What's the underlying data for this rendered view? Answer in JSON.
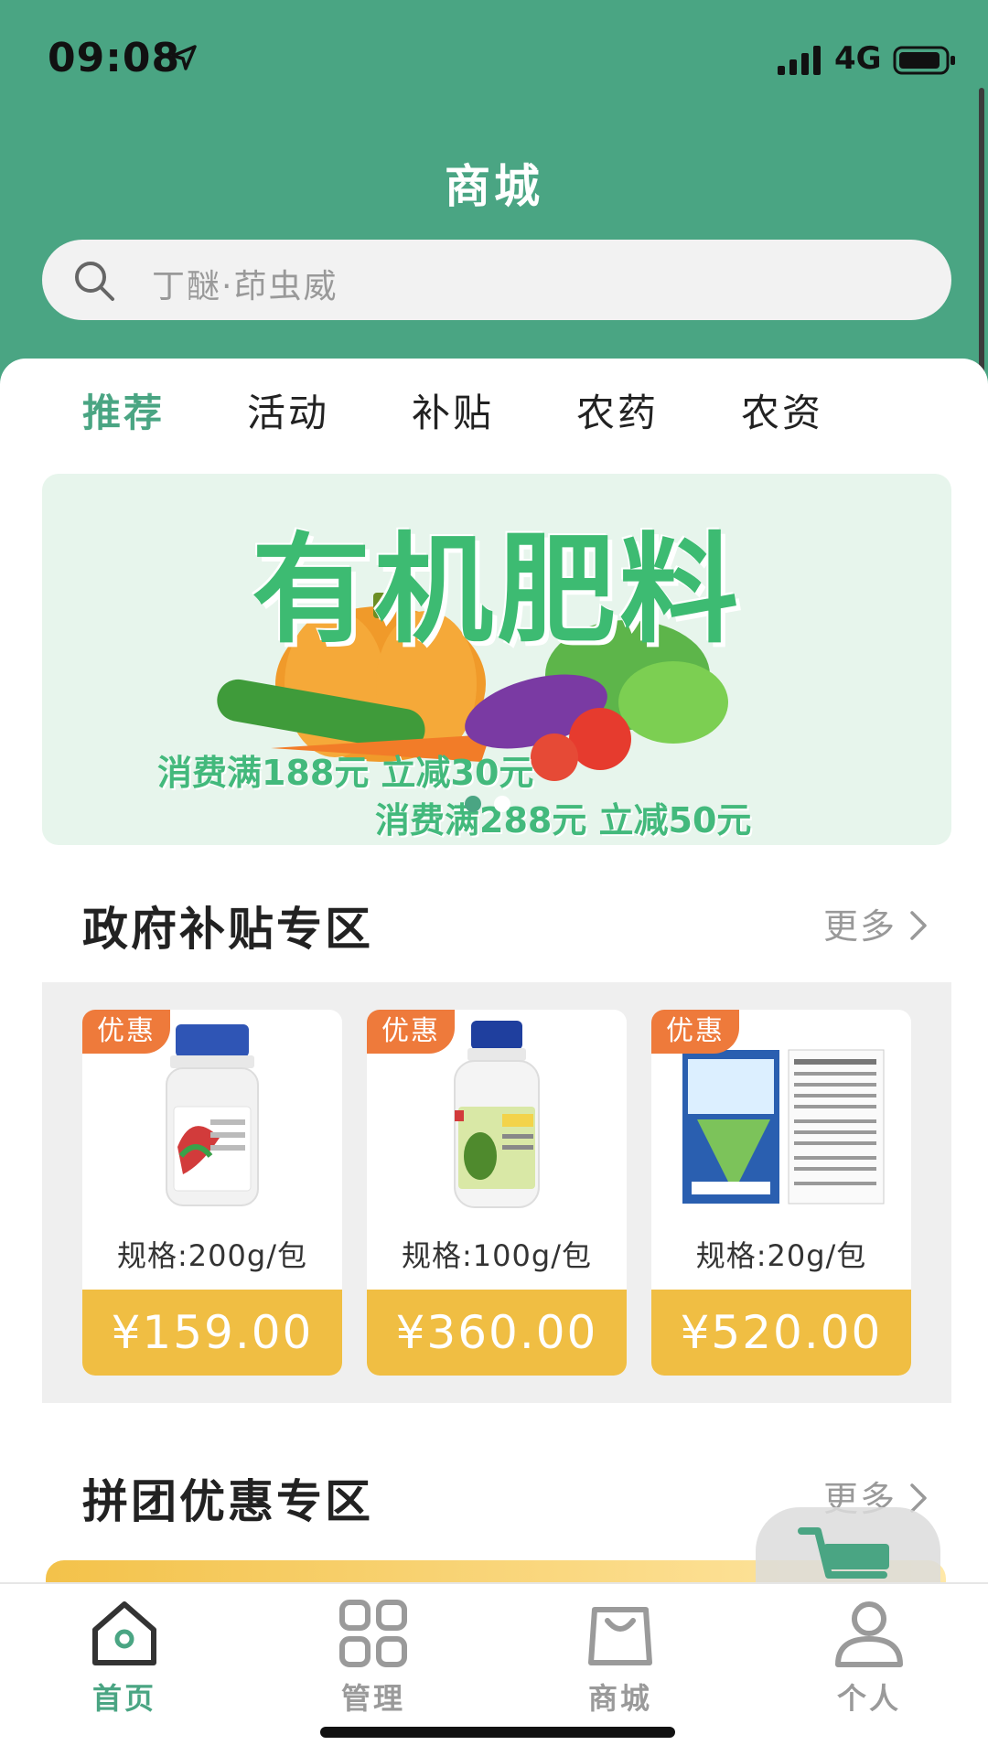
{
  "status_bar": {
    "time": "09:08",
    "network": "4G"
  },
  "header": {
    "title": "商城"
  },
  "search": {
    "placeholder": "丁醚·茚虫威"
  },
  "tabs": [
    {
      "label": "推荐",
      "active": true
    },
    {
      "label": "活动",
      "active": false
    },
    {
      "label": "补贴",
      "active": false
    },
    {
      "label": "农药",
      "active": false
    },
    {
      "label": "农资",
      "active": false
    }
  ],
  "banner": {
    "title": "有机肥料",
    "promo_1": "消费满188元 立减30元",
    "promo_2": "消费满288元 立减50元",
    "slide_count": 2,
    "active_slide": 1
  },
  "subsidy_section": {
    "title": "政府补贴专区",
    "more": "更多",
    "products": [
      {
        "badge": "优惠",
        "spec": "规格:200g/包",
        "price": "¥159.00"
      },
      {
        "badge": "优惠",
        "spec": "规格:100g/包",
        "price": "¥360.00"
      },
      {
        "badge": "优惠",
        "spec": "规格:20g/包",
        "price": "¥520.00"
      }
    ]
  },
  "group_section": {
    "title": "拼团优惠专区",
    "more": "更多"
  },
  "tabbar": [
    {
      "label": "首页",
      "icon": "home-icon",
      "active": true
    },
    {
      "label": "管理",
      "icon": "grid-icon",
      "active": false
    },
    {
      "label": "商城",
      "icon": "shopping-bag-icon",
      "active": false
    },
    {
      "label": "个人",
      "icon": "person-icon",
      "active": false
    }
  ],
  "colors": {
    "brand": "#4aa583",
    "badge": "#ee7a3b",
    "price": "#f0be43"
  }
}
